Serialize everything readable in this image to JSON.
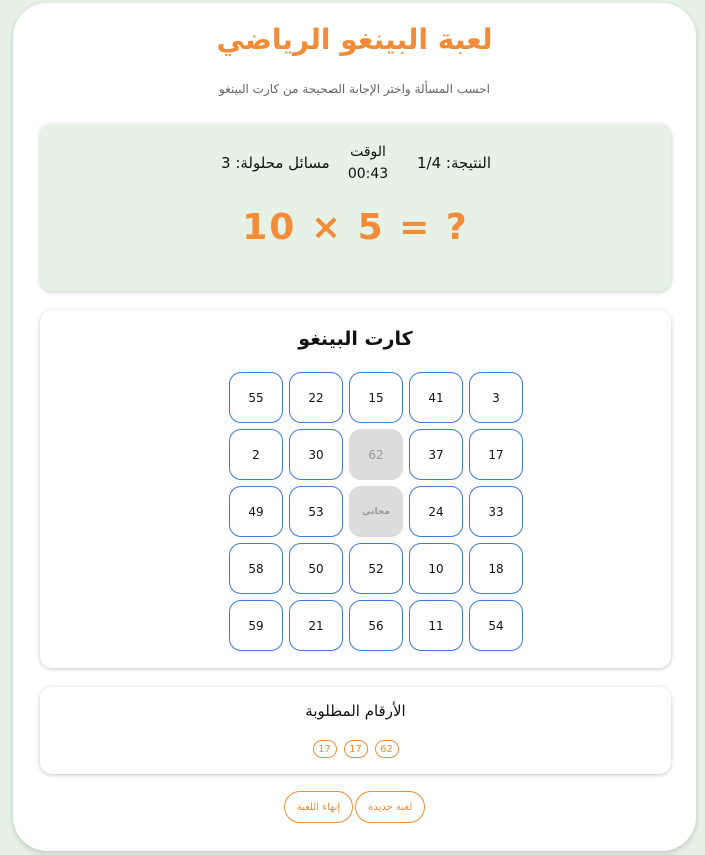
{
  "header": {
    "title": "لعبة البينغو الرياضي",
    "subtitle": "احسب المسألة واختر الإجابة الصحيحة من كارت البينغو"
  },
  "status": {
    "score_label": "النتيجة: 1/4",
    "timer_label": "الوقت",
    "timer_value": "00:43",
    "solved_label": "مسائل محلولة: 3"
  },
  "problem": {
    "text": "10 × 5 = ?"
  },
  "board": {
    "title": "كارت البينغو",
    "rows": [
      [
        {
          "value": "55",
          "marked": false
        },
        {
          "value": "22",
          "marked": false
        },
        {
          "value": "15",
          "marked": false
        },
        {
          "value": "41",
          "marked": false
        },
        {
          "value": "3",
          "marked": false
        }
      ],
      [
        {
          "value": "2",
          "marked": false
        },
        {
          "value": "30",
          "marked": false
        },
        {
          "value": "62",
          "marked": true
        },
        {
          "value": "37",
          "marked": false
        },
        {
          "value": "17",
          "marked": false
        }
      ],
      [
        {
          "value": "49",
          "marked": false
        },
        {
          "value": "53",
          "marked": false
        },
        {
          "value": "مجاني",
          "marked": true,
          "free": true
        },
        {
          "value": "24",
          "marked": false
        },
        {
          "value": "33",
          "marked": false
        }
      ],
      [
        {
          "value": "58",
          "marked": false
        },
        {
          "value": "50",
          "marked": false
        },
        {
          "value": "52",
          "marked": false
        },
        {
          "value": "10",
          "marked": false
        },
        {
          "value": "18",
          "marked": false
        }
      ],
      [
        {
          "value": "59",
          "marked": false
        },
        {
          "value": "21",
          "marked": false
        },
        {
          "value": "56",
          "marked": false
        },
        {
          "value": "11",
          "marked": false
        },
        {
          "value": "54",
          "marked": false
        }
      ]
    ]
  },
  "targets": {
    "title": "الأرقام المطلوبة",
    "numbers": [
      "17",
      "17",
      "62"
    ]
  },
  "actions": {
    "new_game_label": "لعبة جديدة",
    "end_game_label": "إنهاء اللعبة"
  },
  "colors": {
    "accent": "#f28c38",
    "cell_border": "#3a7bd5",
    "marked_cell": "#dcdcdc",
    "status_background": "#e6f2e6"
  }
}
